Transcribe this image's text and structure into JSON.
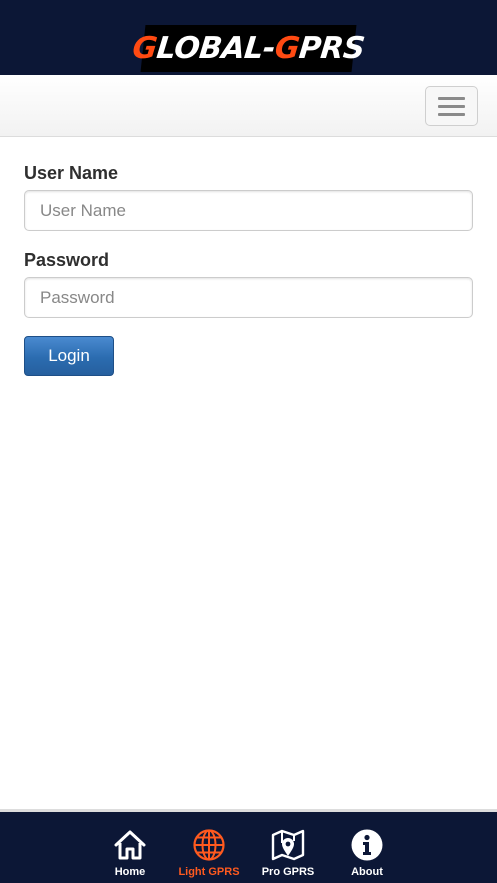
{
  "header": {
    "logo_first_letter": "G",
    "logo_middle": "LOBAL-",
    "logo_second_letter": "G",
    "logo_end": "PRS"
  },
  "form": {
    "username_label": "User Name",
    "username_placeholder": "User Name",
    "password_label": "Password",
    "password_placeholder": "Password",
    "login_label": "Login"
  },
  "tabbar": {
    "active_tab": "Light GPRS",
    "active_color": "#ff5a1f",
    "tabs": [
      {
        "label": "Home",
        "icon": "home-icon"
      },
      {
        "label": "Light GPRS",
        "icon": "globe-icon"
      },
      {
        "label": "Pro GPRS",
        "icon": "map-pin-icon"
      },
      {
        "label": "About",
        "icon": "info-icon"
      }
    ]
  },
  "colors": {
    "header_background": "#0c1736",
    "logo_accent": "#ff4a12",
    "login_button": "#2b6cb0"
  }
}
